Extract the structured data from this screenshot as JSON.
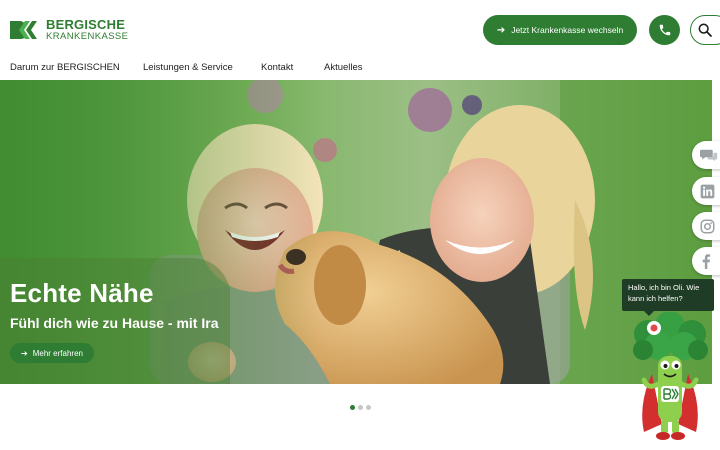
{
  "header": {
    "logo": {
      "line1": "BERGISCHE",
      "line2": "KRANKENKASSE"
    },
    "cta": {
      "label": "Jetzt Krankenkasse wechseln",
      "icon": "arrow-right-icon"
    },
    "phone_icon": "phone-icon",
    "search_icon": "search-icon"
  },
  "nav": {
    "items": [
      {
        "label": "Darum zur BERGISCHEN"
      },
      {
        "label": "Leistungen & Service"
      },
      {
        "label": "Kontakt"
      },
      {
        "label": "Aktuelles"
      }
    ]
  },
  "hero": {
    "title": "Echte Nähe",
    "subtitle": "Fühl dich wie zu Hause - mit Ira",
    "button_label": "Mehr erfahren",
    "button_icon": "arrow-right-icon"
  },
  "social": [
    "chat-icon",
    "linkedin-icon",
    "instagram-icon",
    "facebook-icon"
  ],
  "chatbot": {
    "message": "Hallo, ich bin Oli. Wie kann ich helfen?"
  },
  "carousel": {
    "slides": 3,
    "active": 1
  },
  "colors": {
    "brand": "#2e7d32",
    "dark_green": "#1f3d26",
    "text": "#1d1d1d"
  }
}
